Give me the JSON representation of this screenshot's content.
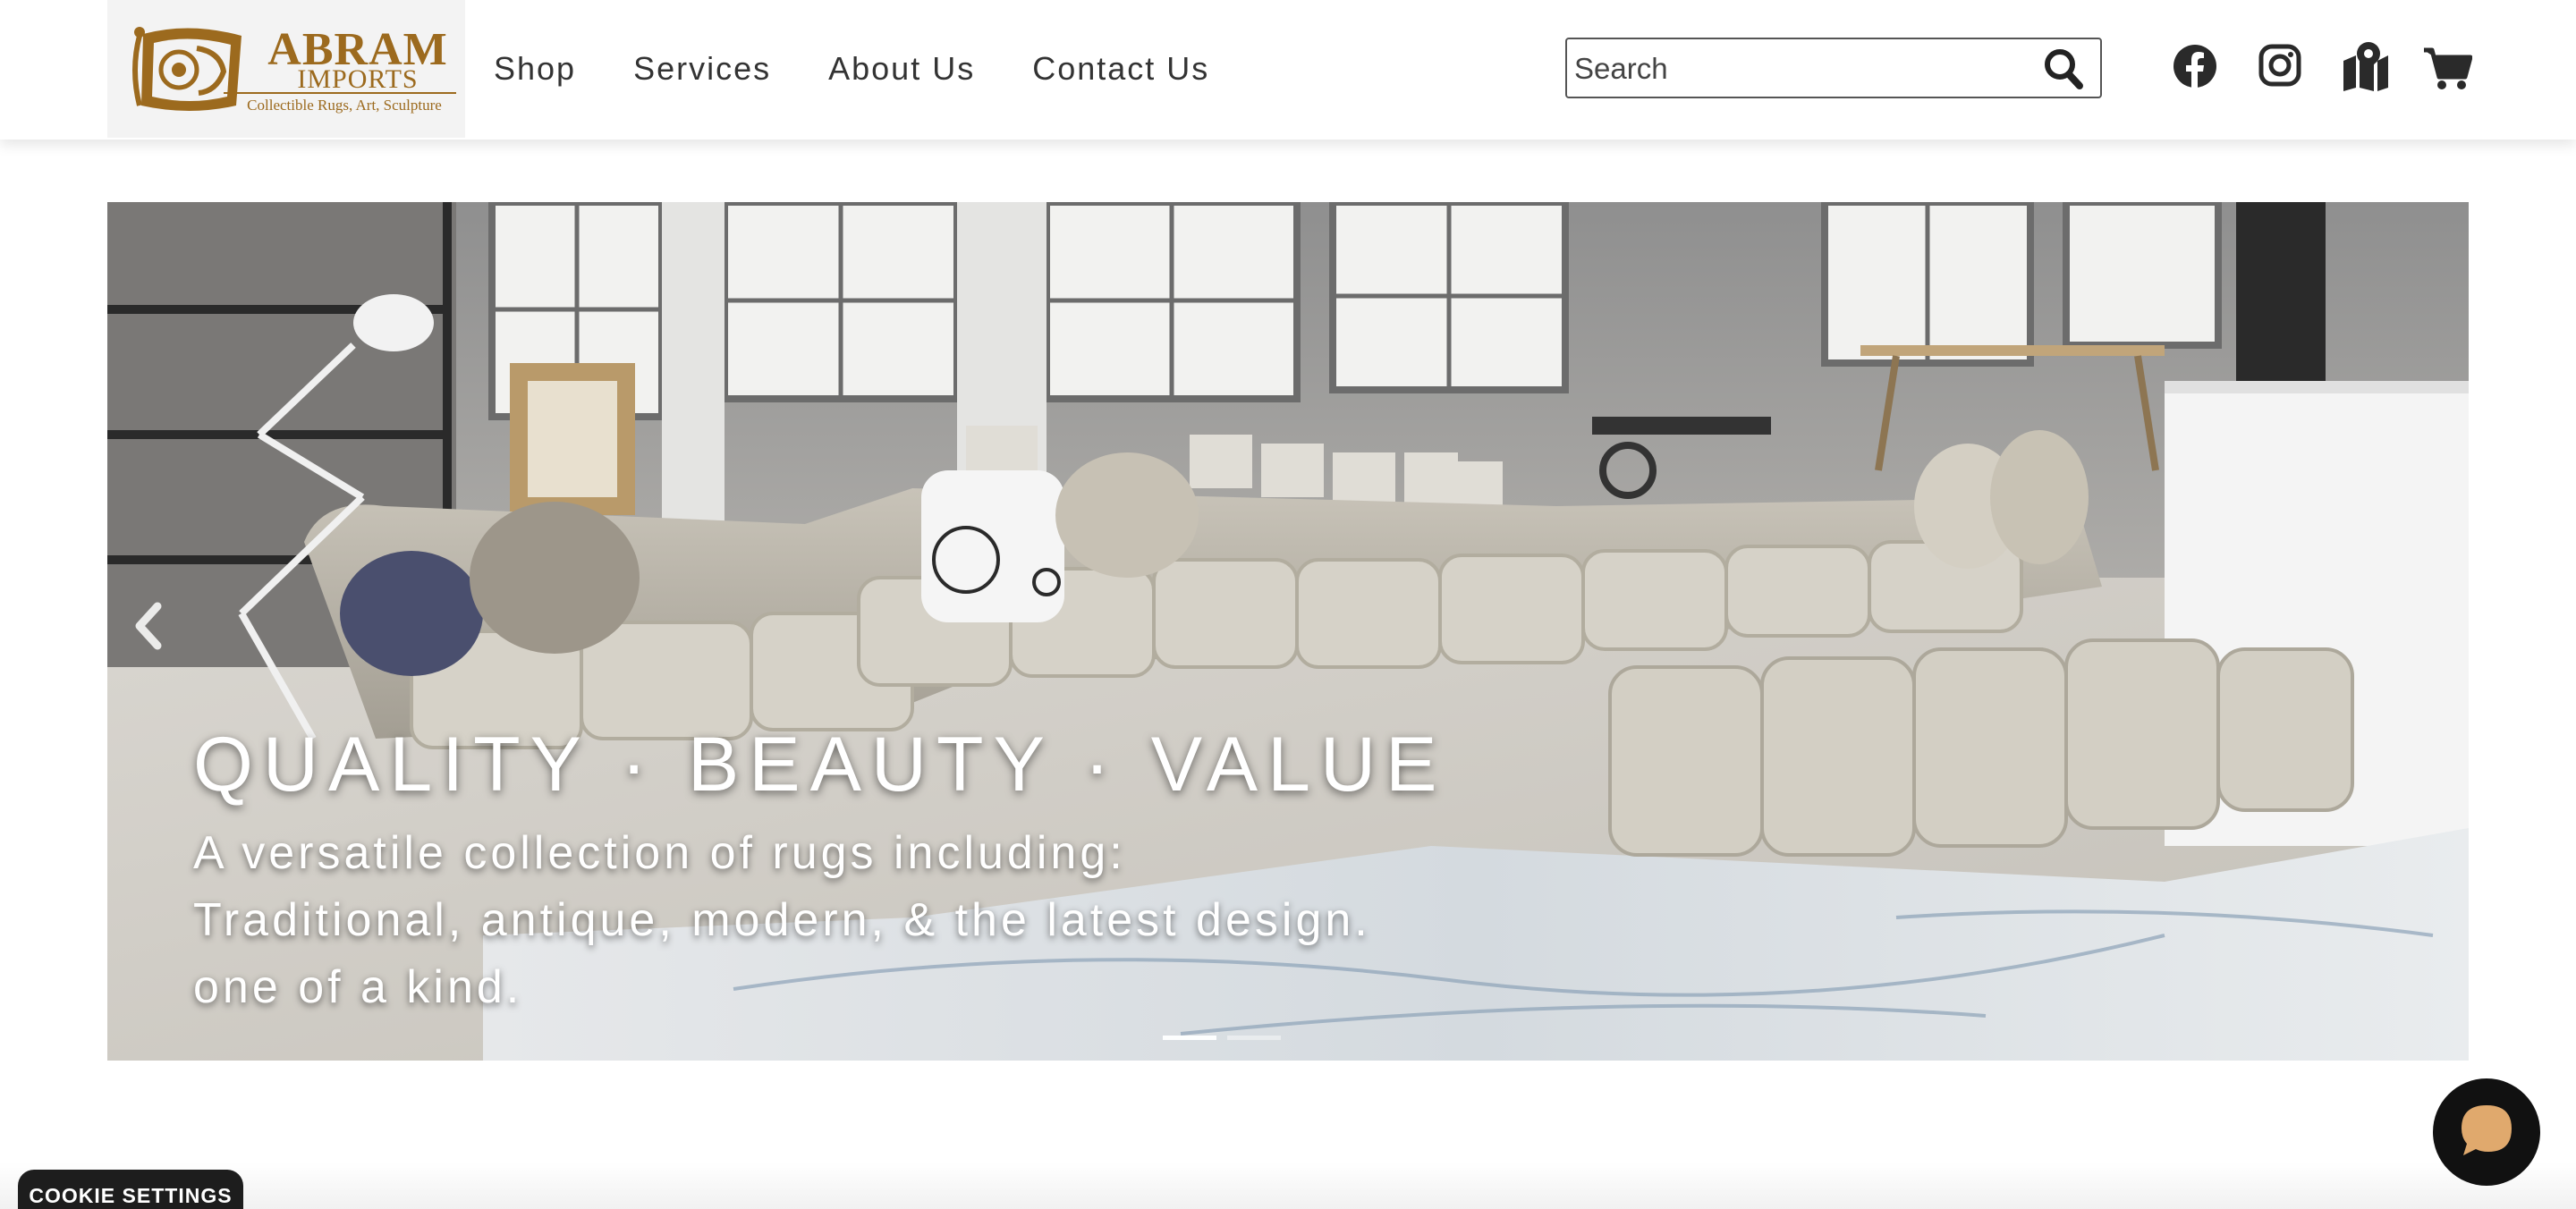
{
  "brand": {
    "name": "ABRAM",
    "sub": "IMPORTS",
    "tagline": "Collectible Rugs, Art, Sculpture",
    "logo_color": "#9c6a1e"
  },
  "nav": {
    "items": [
      {
        "label": "Shop"
      },
      {
        "label": "Services"
      },
      {
        "label": "About Us"
      },
      {
        "label": "Contact Us"
      }
    ]
  },
  "search": {
    "placeholder": "Search",
    "icon": "search-icon"
  },
  "social_icons": [
    "facebook-icon",
    "instagram-icon",
    "map-icon",
    "cart-icon"
  ],
  "hero": {
    "title": "QUALITY · BEAUTY · VALUE",
    "lines": [
      "A versatile collection of rugs including:",
      "Traditional, antique, modern, & the latest design.",
      "one of a kind."
    ],
    "slide_count": 2,
    "active_slide": 1
  },
  "cookie": {
    "label": "COOKIE SETTINGS"
  },
  "chat": {
    "icon": "chat-bubble-icon",
    "accent": "#e0a96d"
  }
}
